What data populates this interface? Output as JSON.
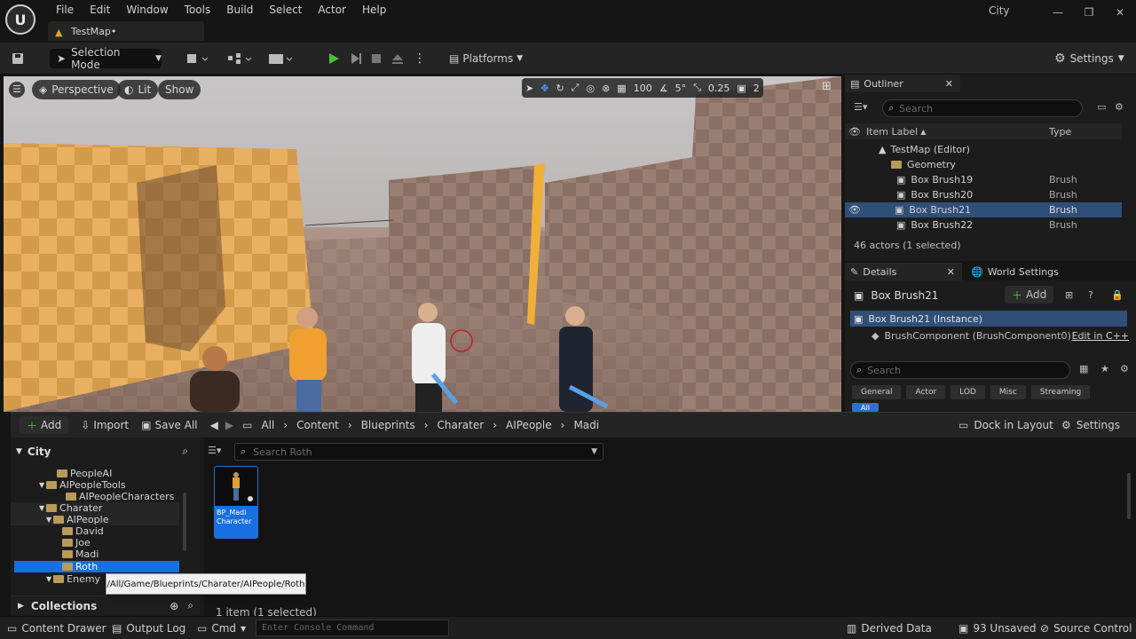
{
  "window": {
    "project_name": "City",
    "document_tab": "TestMap•"
  },
  "menu": [
    "File",
    "Edit",
    "Window",
    "Tools",
    "Build",
    "Select",
    "Actor",
    "Help"
  ],
  "toolbar": {
    "selection_mode": "Selection Mode",
    "platforms": "Platforms",
    "settings": "Settings"
  },
  "viewport": {
    "perspective": "Perspective",
    "lit": "Lit",
    "show": "Show",
    "grid_snap": "100",
    "rotation_snap": "5°",
    "scale_snap": "0.25",
    "camera_speed": "2"
  },
  "outliner": {
    "title": "Outliner",
    "search_placeholder": "Search",
    "col_label": "Item Label",
    "col_type": "Type",
    "rows": [
      {
        "label": "TestMap (Editor)",
        "type": ""
      },
      {
        "label": "Geometry",
        "type": ""
      },
      {
        "label": "Box Brush19",
        "type": "Brush"
      },
      {
        "label": "Box Brush20",
        "type": "Brush"
      },
      {
        "label": "Box Brush21",
        "type": "Brush"
      },
      {
        "label": "Box Brush22",
        "type": "Brush"
      }
    ],
    "footer": "46 actors (1 selected)"
  },
  "details": {
    "tab_details": "Details",
    "tab_world": "World Settings",
    "object_name": "Box Brush21",
    "add_label": "Add",
    "instance": "Box Brush21 (Instance)",
    "component": "BrushComponent (BrushComponent0)",
    "edit_cpp": "Edit in C++",
    "search_placeholder": "Search",
    "filters": [
      "General",
      "Actor",
      "LOD",
      "Misc",
      "Streaming"
    ],
    "all_chip": "All"
  },
  "drawer": {
    "add": "Add",
    "import": "Import",
    "save_all": "Save All",
    "breadcrumb": [
      "All",
      "Content",
      "Blueprints",
      "Charater",
      "AIPeople",
      "Madi"
    ],
    "dock": "Dock in Layout",
    "settings": "Settings",
    "root": "City",
    "folders": [
      "PeopleAI",
      "AIPeopleTools",
      "AIPeopleCharacters",
      "Charater",
      "AIPeople",
      "David",
      "Joe",
      "Madi",
      "Roth",
      "Enemy"
    ],
    "collections": "Collections",
    "search_placeholder": "Search Roth",
    "asset_name": "BP_Madi Character",
    "item_count": "1 item (1 selected)",
    "tooltip": "/All/Game/Blueprints/Charater/AIPeople/Roth"
  },
  "statusbar": {
    "content_drawer": "Content Drawer",
    "output_log": "Output Log",
    "cmd": "Cmd",
    "console_placeholder": "Enter Console Command",
    "derived_data": "Derived Data",
    "unsaved": "93 Unsaved",
    "source_control": "Source Control"
  }
}
